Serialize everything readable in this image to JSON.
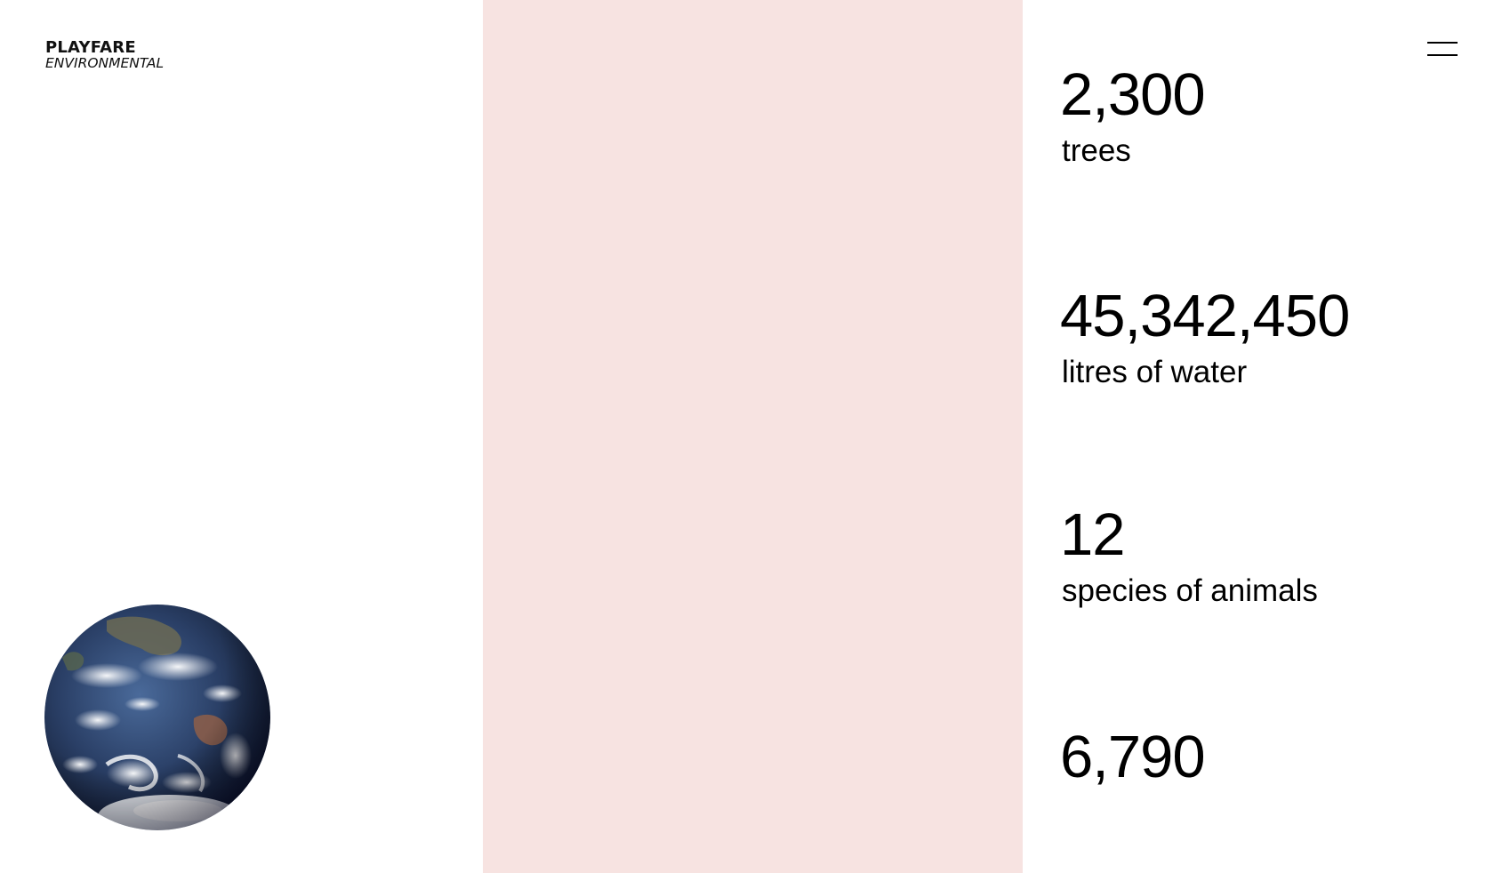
{
  "brand": {
    "line1": "PLAYFARE",
    "line2": "ENVIRONMENTAL"
  },
  "menu": {
    "icon": "hamburger-menu-icon"
  },
  "image": {
    "subject": "earth-globe-image"
  },
  "colors": {
    "panel": "#f7e3e1",
    "background": "#ffffff",
    "text": "#000000"
  },
  "stats": [
    {
      "number": "2,300",
      "label": "trees"
    },
    {
      "number": "45,342,450",
      "label": "litres of water"
    },
    {
      "number": "12",
      "label": "species of animals"
    },
    {
      "number": "6,790",
      "label": ""
    }
  ]
}
